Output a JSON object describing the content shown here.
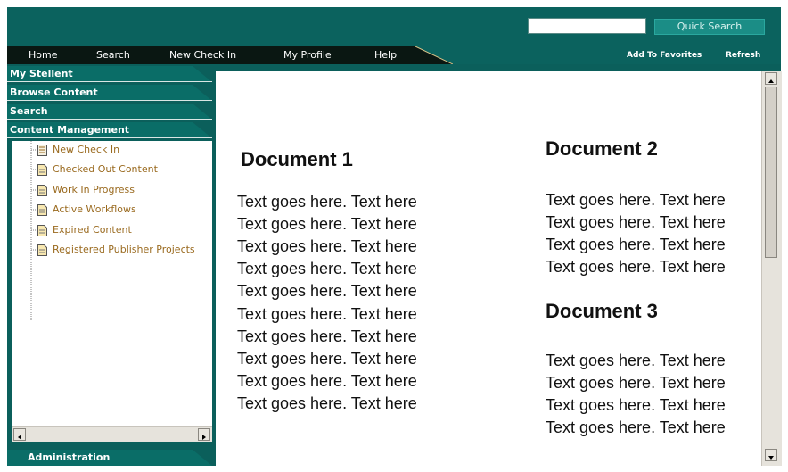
{
  "quick_search": {
    "input_value": "",
    "button_label": "Quick Search"
  },
  "nav": {
    "items": [
      "Home",
      "Search",
      "New Check In",
      "My Profile",
      "Help"
    ],
    "right": [
      "Add To Favorites",
      "Refresh"
    ]
  },
  "sidebar": {
    "tabs": [
      "My Stellent",
      "Browse Content",
      "Search",
      "Content Management"
    ],
    "tree_items": [
      "New Check In",
      "Checked Out Content",
      "Work In Progress",
      "Active Workflows",
      "Expired Content",
      "Registered Publisher Projects"
    ],
    "bottom_tab": "Administration"
  },
  "content": {
    "doc1": {
      "title": "Document 1",
      "lines": [
        "Text goes here. Text here",
        "Text goes here. Text here",
        "Text goes here. Text here",
        "Text goes here. Text here",
        "Text goes here. Text here",
        "Text goes here. Text here",
        "Text goes here. Text here",
        "Text goes here. Text here",
        "Text goes here. Text here",
        "Text goes here. Text here"
      ]
    },
    "doc2": {
      "title": "Document 2",
      "lines": [
        "Text goes here. Text here",
        "Text goes here. Text here",
        "Text goes here. Text here",
        "Text goes here. Text here"
      ]
    },
    "doc3": {
      "title": "Document 3",
      "lines": [
        "Text goes here. Text here",
        "Text goes here. Text here",
        "Text goes here. Text here",
        "Text goes here. Text here"
      ]
    }
  },
  "colors": {
    "frame": "#0b5f5b",
    "nav_dark": "#0a1712",
    "tab": "#0a6d67",
    "tree_label": "#9a6a1f",
    "quick_search_button": "#1b8d86"
  }
}
